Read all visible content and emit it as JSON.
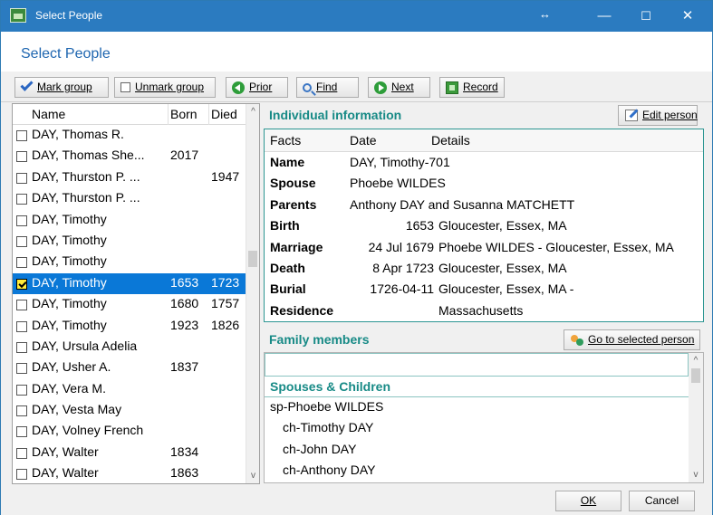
{
  "window": {
    "title": "Select People",
    "resize_glyph": "↔",
    "controls": {
      "minimize": "—",
      "maximize": "☐",
      "close": "✕"
    }
  },
  "page_title": "Select People",
  "toolbar": {
    "mark_group": "Mark group",
    "unmark_group": "Unmark group",
    "prior": "Prior",
    "find": "Find",
    "next": "Next",
    "record": "Record"
  },
  "people": {
    "columns": {
      "name": "Name",
      "born": "Born",
      "died": "Died"
    },
    "rows": [
      {
        "name": "DAY, Thomas R.",
        "born": "",
        "died": "",
        "checked": false,
        "selected": false
      },
      {
        "name": "DAY, Thomas She...",
        "born": "2017",
        "died": "",
        "checked": false,
        "selected": false
      },
      {
        "name": "DAY, Thurston P. ...",
        "born": "",
        "died": "1947",
        "checked": false,
        "selected": false
      },
      {
        "name": "DAY, Thurston P. ...",
        "born": "",
        "died": "",
        "checked": false,
        "selected": false
      },
      {
        "name": "DAY, Timothy",
        "born": "",
        "died": "",
        "checked": false,
        "selected": false
      },
      {
        "name": "DAY, Timothy",
        "born": "",
        "died": "",
        "checked": false,
        "selected": false
      },
      {
        "name": "DAY, Timothy",
        "born": "",
        "died": "",
        "checked": false,
        "selected": false
      },
      {
        "name": "DAY, Timothy",
        "born": "1653",
        "died": "1723",
        "checked": true,
        "selected": true
      },
      {
        "name": "DAY, Timothy",
        "born": "1680",
        "died": "1757",
        "checked": false,
        "selected": false
      },
      {
        "name": "DAY, Timothy",
        "born": "1923",
        "died": "1826",
        "checked": false,
        "selected": false
      },
      {
        "name": "DAY, Ursula Adelia",
        "born": "",
        "died": "",
        "checked": false,
        "selected": false
      },
      {
        "name": "DAY, Usher A.",
        "born": "1837",
        "died": "",
        "checked": false,
        "selected": false
      },
      {
        "name": "DAY, Vera M.",
        "born": "",
        "died": "",
        "checked": false,
        "selected": false
      },
      {
        "name": "DAY, Vesta May",
        "born": "",
        "died": "",
        "checked": false,
        "selected": false
      },
      {
        "name": "DAY, Volney French",
        "born": "",
        "died": "",
        "checked": false,
        "selected": false
      },
      {
        "name": "DAY, Walter",
        "born": "1834",
        "died": "",
        "checked": false,
        "selected": false
      },
      {
        "name": "DAY, Walter",
        "born": "1863",
        "died": "",
        "checked": false,
        "selected": false
      }
    ],
    "scroll_up": "^",
    "scroll_down": "v"
  },
  "individual": {
    "title": "Individual information",
    "edit_button": "Edit person",
    "columns": {
      "facts": "Facts",
      "date": "Date",
      "details": "Details"
    },
    "rows": [
      {
        "fact": "Name",
        "date": "DAY, Timothy-701",
        "details": ""
      },
      {
        "fact": "Spouse",
        "date": "Phoebe WILDES",
        "details": ""
      },
      {
        "fact": "Parents",
        "date": "Anthony DAY and Susanna MATCHETT",
        "details": ""
      },
      {
        "fact": "Birth",
        "date": "1653",
        "details": "Gloucester, Essex, MA"
      },
      {
        "fact": "Marriage",
        "date": "24 Jul 1679",
        "details": "Phoebe WILDES - Gloucester, Essex, MA"
      },
      {
        "fact": "Death",
        "date": "8 Apr 1723",
        "details": "Gloucester, Essex, MA"
      },
      {
        "fact": "Burial",
        "date": "1726-04-11",
        "details": "Gloucester, Essex, MA -"
      },
      {
        "fact": "Residence",
        "date": "",
        "details": "Massachusetts"
      }
    ]
  },
  "family": {
    "title": "Family members",
    "goto_button": "Go to selected person",
    "section": "Spouses & Children",
    "rows": [
      {
        "text": "sp-Phoebe WILDES",
        "indent": 0
      },
      {
        "text": "ch-Timothy DAY",
        "indent": 1
      },
      {
        "text": "ch-John DAY",
        "indent": 1
      },
      {
        "text": "ch-Anthony DAY",
        "indent": 1
      }
    ]
  },
  "dialog": {
    "ok": "OK",
    "cancel": "Cancel"
  }
}
